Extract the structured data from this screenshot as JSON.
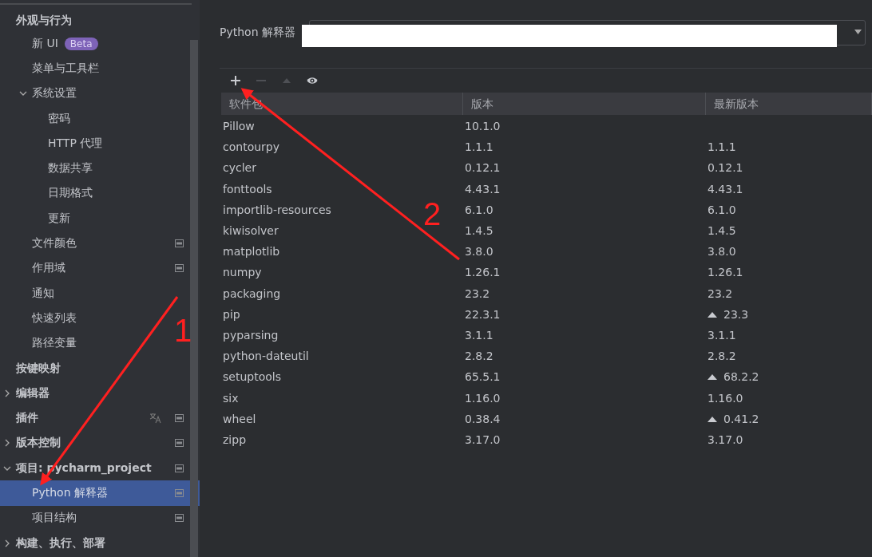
{
  "sidebar": {
    "items": [
      {
        "label": "外观与行为",
        "bold": true,
        "selected": false,
        "children": [
          {
            "label": "新 UI",
            "badge": "Beta",
            "selected": false
          },
          {
            "label": "菜单与工具栏",
            "selected": false
          },
          {
            "label": "系统设置",
            "expanded": true,
            "selected": false,
            "children": [
              {
                "label": "密码",
                "selected": false
              },
              {
                "label": "HTTP 代理",
                "selected": false
              },
              {
                "label": "数据共享",
                "selected": false
              },
              {
                "label": "日期格式",
                "selected": false
              },
              {
                "label": "更新",
                "selected": false
              }
            ]
          },
          {
            "label": "文件颜色",
            "project_scoped": true,
            "selected": false
          },
          {
            "label": "作用域",
            "project_scoped": true,
            "selected": false
          },
          {
            "label": "通知",
            "selected": false
          },
          {
            "label": "快速列表",
            "selected": false
          },
          {
            "label": "路径变量",
            "selected": false
          }
        ]
      },
      {
        "label": "按键映射",
        "bold": true,
        "selected": false
      },
      {
        "label": "编辑器",
        "bold": true,
        "expanded": false,
        "selected": false
      },
      {
        "label": "插件",
        "bold": true,
        "translatable": true,
        "project_scoped": true,
        "selected": false
      },
      {
        "label": "版本控制",
        "bold": true,
        "expanded": false,
        "project_scoped": true,
        "selected": false
      },
      {
        "label": "项目: pycharm_project",
        "bold": true,
        "expanded": true,
        "project_scoped": true,
        "selected": false,
        "children": [
          {
            "label": "Python 解释器",
            "project_scoped": true,
            "selected": true
          },
          {
            "label": "项目结构",
            "project_scoped": true,
            "selected": false
          }
        ]
      },
      {
        "label": "构建、执行、部署",
        "bold": true,
        "expanded": false,
        "selected": false
      }
    ]
  },
  "interpreter": {
    "label": "Python 解释器",
    "value_redacted": true
  },
  "toolbar": [
    {
      "kind": "add",
      "disabled": false
    },
    {
      "kind": "remove",
      "disabled": true
    },
    {
      "kind": "upgrade",
      "disabled": true
    },
    {
      "kind": "show",
      "disabled": false
    }
  ],
  "table": {
    "columns": [
      "软件包",
      "版本",
      "最新版本"
    ],
    "rows": [
      {
        "name": "Pillow",
        "version": "10.1.0",
        "upgrade": false
      },
      {
        "name": "contourpy",
        "version": "1.1.1",
        "latest": "1.1.1",
        "upgrade": false
      },
      {
        "name": "cycler",
        "version": "0.12.1",
        "latest": "0.12.1",
        "upgrade": false
      },
      {
        "name": "fonttools",
        "version": "4.43.1",
        "latest": "4.43.1",
        "upgrade": false
      },
      {
        "name": "importlib-resources",
        "version": "6.1.0",
        "latest": "6.1.0",
        "upgrade": false
      },
      {
        "name": "kiwisolver",
        "version": "1.4.5",
        "latest": "1.4.5",
        "upgrade": false
      },
      {
        "name": "matplotlib",
        "version": "3.8.0",
        "latest": "3.8.0",
        "upgrade": false
      },
      {
        "name": "numpy",
        "version": "1.26.1",
        "latest": "1.26.1",
        "upgrade": false
      },
      {
        "name": "packaging",
        "version": "23.2",
        "latest": "23.2",
        "upgrade": false
      },
      {
        "name": "pip",
        "version": "22.3.1",
        "latest": "23.3",
        "upgrade": true
      },
      {
        "name": "pyparsing",
        "version": "3.1.1",
        "latest": "3.1.1",
        "upgrade": false
      },
      {
        "name": "python-dateutil",
        "version": "2.8.2",
        "latest": "2.8.2",
        "upgrade": false
      },
      {
        "name": "setuptools",
        "version": "65.5.1",
        "latest": "68.2.2",
        "upgrade": true
      },
      {
        "name": "six",
        "version": "1.16.0",
        "latest": "1.16.0",
        "upgrade": false
      },
      {
        "name": "wheel",
        "version": "0.38.4",
        "latest": "0.41.2",
        "upgrade": true
      },
      {
        "name": "zipp",
        "version": "3.17.0",
        "latest": "3.17.0",
        "upgrade": false
      }
    ]
  },
  "annotations": [
    {
      "label": "1"
    },
    {
      "label": "2"
    }
  ]
}
